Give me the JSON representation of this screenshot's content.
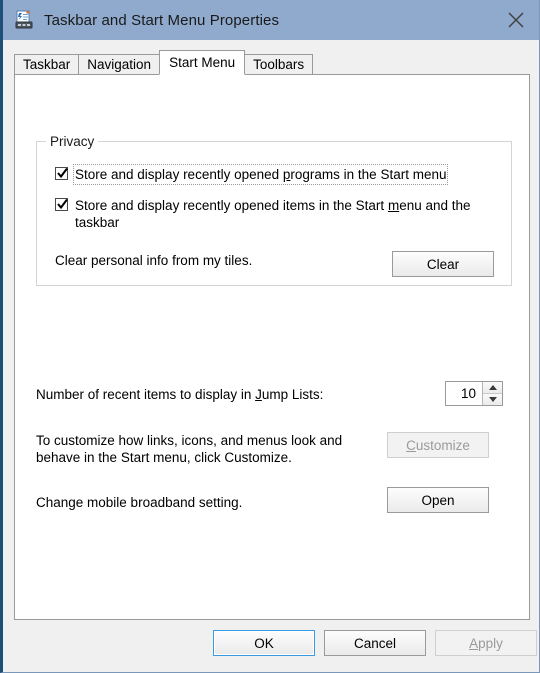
{
  "window": {
    "title": "Taskbar and Start Menu Properties",
    "icon": "taskbar-properties-icon",
    "close_label": "×",
    "titlebar_color": "#8faacd",
    "accent_color": "#1f4e79"
  },
  "tabs": [
    {
      "label": "Taskbar",
      "selected": false
    },
    {
      "label": "Navigation",
      "selected": false
    },
    {
      "label": "Start Menu",
      "selected": true
    },
    {
      "label": "Toolbars",
      "selected": false
    }
  ],
  "privacy": {
    "legend": "Privacy",
    "checkbox_programs": {
      "checked": true,
      "focused": true,
      "text_before": "Store and display recently opened ",
      "accel": "p",
      "text_after": "rograms in the Start menu"
    },
    "checkbox_items": {
      "checked": true,
      "focused": false,
      "text_before": "Store and display recently opened items in the Start ",
      "accel": "m",
      "text_after": "enu and the taskbar"
    },
    "clear_row": {
      "description": "Clear personal info from my tiles.",
      "button_label": "Clear",
      "button_enabled": true
    }
  },
  "jump_lists": {
    "label_before": "Number of recent items to display in ",
    "accel": "J",
    "label_after": "ump Lists:",
    "value": "10",
    "spin_up": "increment",
    "spin_down": "decrement"
  },
  "customize_row": {
    "description": "To customize how links, icons, and menus look and behave in the Start menu, click Customize.",
    "button_accel": "C",
    "button_label_after": "ustomize",
    "button_enabled": false
  },
  "broadband_row": {
    "description": "Change mobile broadband setting.",
    "button_label": "Open",
    "button_enabled": true
  },
  "footer": {
    "ok": {
      "label": "OK",
      "default": true,
      "enabled": true
    },
    "cancel": {
      "label": "Cancel",
      "default": false,
      "enabled": true
    },
    "apply": {
      "accel": "A",
      "label_after": "pply",
      "default": false,
      "enabled": false
    }
  }
}
